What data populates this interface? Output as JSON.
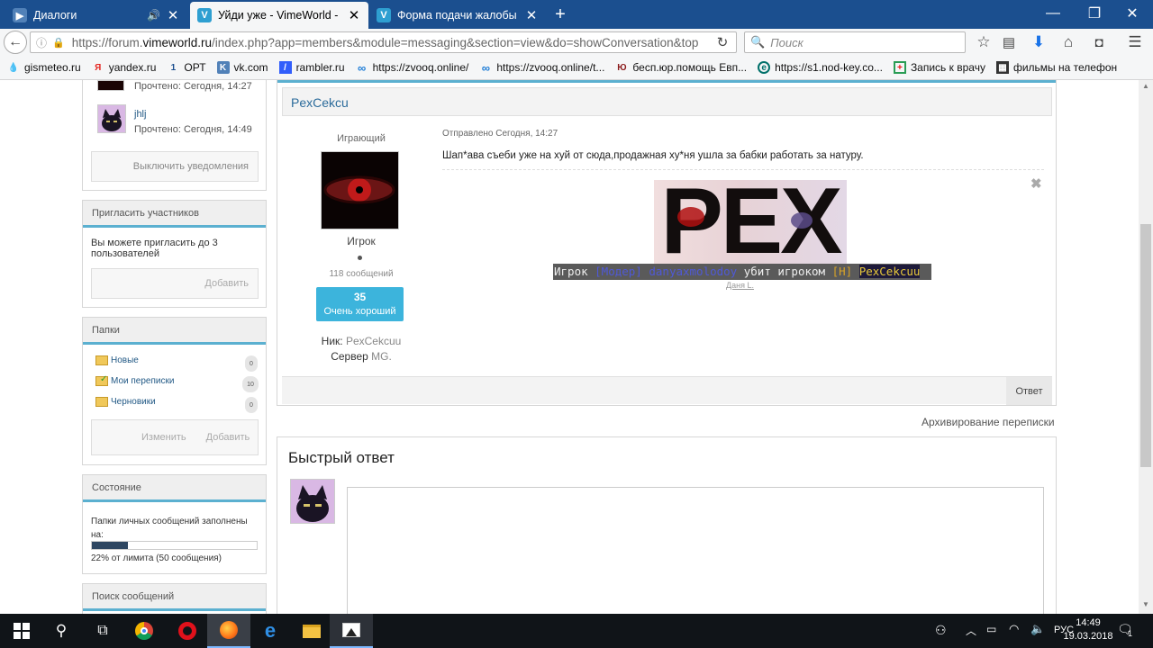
{
  "tabs": [
    {
      "title": "Диалоги",
      "icon": "vk-icon",
      "active": false
    },
    {
      "title": "Уйди уже - VimeWorld - ...",
      "icon": "vimeworld-icon",
      "active": true
    },
    {
      "title": "Форма подачи жалобы н...",
      "icon": "vimeworld-icon",
      "active": false
    }
  ],
  "new_tab_label": "+",
  "url": {
    "prefix": "https://forum.",
    "domain": "vimeworld.ru",
    "path": "/index.php?app=members&module=messaging&section=view&do=showConversation&top"
  },
  "search_placeholder": "Поиск",
  "bookmarks": [
    {
      "label": "gismeteo.ru",
      "icon": "gismeteo-icon"
    },
    {
      "label": "yandex.ru",
      "icon": "yandex-icon"
    },
    {
      "label": "ОРТ",
      "icon": "ort-icon"
    },
    {
      "label": "vk.com",
      "icon": "vk-icon"
    },
    {
      "label": "rambler.ru",
      "icon": "rambler-icon"
    },
    {
      "label": "https://zvooq.online/",
      "icon": "zvooq-icon"
    },
    {
      "label": "https://zvooq.online/t...",
      "icon": "zvooq-icon"
    },
    {
      "label": "бесп.юр.помощь Евп...",
      "icon": "law-icon"
    },
    {
      "label": "https://s1.nod-key.co...",
      "icon": "nod-icon"
    },
    {
      "label": "Запись к врачу",
      "icon": "doctor-icon"
    },
    {
      "label": "фильмы на телефон",
      "icon": "film-icon"
    }
  ],
  "sidebar": {
    "participants": [
      {
        "name": "",
        "read": "Прочтено: Сегодня, 14:27"
      },
      {
        "name": "jhlj",
        "read": "Прочтено: Сегодня, 14:49"
      }
    ],
    "notify_button": "Выключить уведомления",
    "invite": {
      "title": "Пригласить участников",
      "text": "Вы можете пригласить до 3 пользователей",
      "add_button": "Добавить"
    },
    "folders": {
      "title": "Папки",
      "items": [
        {
          "label": "Новые",
          "count": "0"
        },
        {
          "label": "Мои переписки",
          "count": "10"
        },
        {
          "label": "Черновики",
          "count": "0"
        }
      ],
      "edit_button": "Изменить",
      "add_button": "Добавить"
    },
    "status": {
      "title": "Состояние",
      "text": "Папки личных сообщений заполнены на:",
      "fill_percent": 22,
      "limit_text": "22% от лимита (50 сообщения)"
    },
    "search_title": "Поиск сообщений"
  },
  "post": {
    "author": "PexCekcu",
    "group": "Играющий",
    "rank": "Игрок",
    "posts_count": "118 сообщений",
    "rep_value": "35",
    "rep_label": "Очень хороший",
    "nick_label": "Ник:",
    "nick_value": "PexCekcuu",
    "server_label": "Сервер",
    "server_value": "MG.",
    "sent": "Отправлено Сегодня, 14:27",
    "text": "Шап*ава съеби уже на хуй от сюда,продажная ху*ня ушла за бабки работать за натуру.",
    "signature_logo": "PEX",
    "signature_caption_parts": [
      "Игрок ",
      "[Модер] ",
      "danyaxmolodoy",
      " убит игроком ",
      "[Н] ",
      "PexCekcuu"
    ],
    "signature_name": "Даня L.",
    "reply_button": "Ответ"
  },
  "archive_link": "Архивирование переписки",
  "quick_reply": {
    "title": "Быстрый ответ"
  },
  "taskbar": {
    "lang": "РУС",
    "time": "14:49",
    "date": "19.03.2018",
    "notifications": "1"
  }
}
